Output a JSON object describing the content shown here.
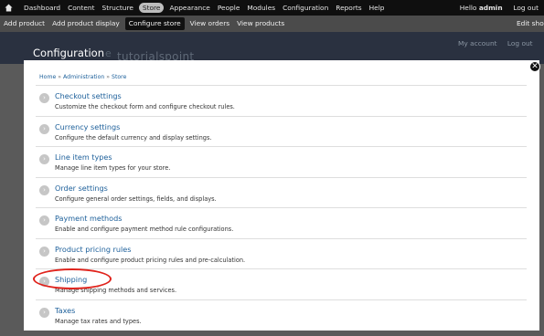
{
  "toolbar": {
    "menu": [
      "Dashboard",
      "Content",
      "Structure",
      "Store",
      "Appearance",
      "People",
      "Modules",
      "Configuration",
      "Reports",
      "Help"
    ],
    "active": "Store",
    "greeting": "Hello",
    "user": "admin",
    "logout": "Log out"
  },
  "shortcuts": {
    "items": [
      "Add product",
      "Add product display",
      "Configure store",
      "View orders",
      "View products"
    ],
    "active": "Configure store",
    "edit": "Edit shor"
  },
  "header": {
    "title": "Configuration",
    "subtitle": "e",
    "watermark": "tutorialspoint",
    "links": [
      "My account",
      "Log out"
    ]
  },
  "breadcrumb": [
    "Home",
    "Administration",
    "Store"
  ],
  "items": [
    {
      "label": "Checkout settings",
      "desc": "Customize the checkout form and configure checkout rules."
    },
    {
      "label": "Currency settings",
      "desc": "Configure the default currency and display settings."
    },
    {
      "label": "Line item types",
      "desc": "Manage line item types for your store."
    },
    {
      "label": "Order settings",
      "desc": "Configure general order settings, fields, and displays."
    },
    {
      "label": "Payment methods",
      "desc": "Enable and configure payment method rule configurations."
    },
    {
      "label": "Product pricing rules",
      "desc": "Enable and configure product pricing rules and pre-calculation."
    },
    {
      "label": "Shipping",
      "desc": "Manage shipping methods and services."
    },
    {
      "label": "Taxes",
      "desc": "Manage tax rates and types."
    }
  ],
  "close_icon": "close-icon",
  "highlight_color": "#e0231c"
}
